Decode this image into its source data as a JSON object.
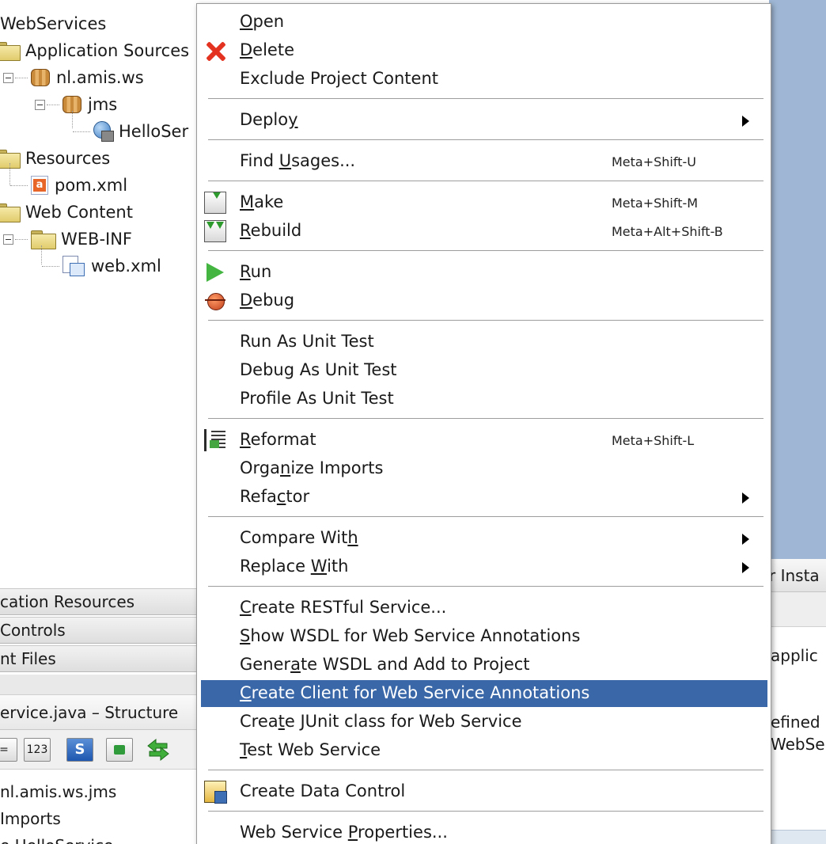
{
  "project_tree": {
    "root_label": "WebServices",
    "items": [
      {
        "label": "Application Sources",
        "icon": "folder-icon"
      },
      {
        "label": "nl.amis.ws",
        "icon": "package-icon"
      },
      {
        "label": "jms",
        "icon": "package-icon"
      },
      {
        "label": "HelloSer",
        "icon": "web-service-icon"
      },
      {
        "label": "Resources",
        "icon": "folder-icon"
      },
      {
        "label": "pom.xml",
        "icon": "maven-file-icon"
      },
      {
        "label": "Web Content",
        "icon": "folder-icon"
      },
      {
        "label": "WEB-INF",
        "icon": "folder-icon"
      },
      {
        "label": "web.xml",
        "icon": "xml-file-icon"
      }
    ]
  },
  "accordions": [
    {
      "label": "cation Resources"
    },
    {
      "label": "Controls"
    },
    {
      "label": "nt Files"
    }
  ],
  "structure": {
    "title": "ervice.java – Structure",
    "toolbar": {
      "btn_sort_label": "=",
      "btn_123_label": "123",
      "btn_s_label": "S"
    },
    "rows": [
      {
        "label": "nl.amis.ws.jms"
      },
      {
        "label": "Imports"
      },
      {
        "label": "e HelloService"
      }
    ]
  },
  "right_panel": {
    "tab_label": "r Insta",
    "line1": "applic",
    "line2": "efined",
    "line3": "WebSer"
  },
  "context_menu": {
    "items": [
      {
        "pre": "",
        "u": "O",
        "post": "pen",
        "shortcut": "",
        "icon": ""
      },
      {
        "pre": "",
        "u": "D",
        "post": "elete",
        "shortcut": "",
        "icon": "delete-icon"
      },
      {
        "pre": "Exclude Project Content",
        "u": "",
        "post": "",
        "shortcut": "",
        "icon": ""
      },
      {
        "pre": "Deplo",
        "u": "y",
        "post": "",
        "shortcut": "",
        "icon": "",
        "submenu": true
      },
      {
        "pre": "Find ",
        "u": "U",
        "post": "sages...",
        "shortcut": "Meta+Shift-U",
        "icon": ""
      },
      {
        "pre": "",
        "u": "M",
        "post": "ake",
        "shortcut": "Meta+Shift-M",
        "icon": "make-icon"
      },
      {
        "pre": "",
        "u": "R",
        "post": "ebuild",
        "shortcut": "Meta+Alt+Shift-B",
        "icon": "rebuild-icon"
      },
      {
        "pre": "",
        "u": "R",
        "post": "un",
        "shortcut": "",
        "icon": "run-icon"
      },
      {
        "pre": "",
        "u": "D",
        "post": "ebug",
        "shortcut": "",
        "icon": "debug-icon"
      },
      {
        "pre": "Run As Unit Test",
        "u": "",
        "post": "",
        "shortcut": "",
        "icon": ""
      },
      {
        "pre": "Debug As Unit Test",
        "u": "",
        "post": "",
        "shortcut": "",
        "icon": ""
      },
      {
        "pre": "Profile As Unit Test",
        "u": "",
        "post": "",
        "shortcut": "",
        "icon": ""
      },
      {
        "pre": "",
        "u": "R",
        "post": "eformat",
        "shortcut": "Meta+Shift-L",
        "icon": "reformat-icon"
      },
      {
        "pre": "Orga",
        "u": "n",
        "post": "ize Imports",
        "shortcut": "",
        "icon": ""
      },
      {
        "pre": "Refa",
        "u": "c",
        "post": "tor",
        "shortcut": "",
        "icon": "",
        "submenu": true
      },
      {
        "pre": "Compare Wit",
        "u": "h",
        "post": "",
        "shortcut": "",
        "icon": "",
        "submenu": true
      },
      {
        "pre": "Replace ",
        "u": "W",
        "post": "ith",
        "shortcut": "",
        "icon": "",
        "submenu": true
      },
      {
        "pre": "",
        "u": "C",
        "post": "reate RESTful Service...",
        "shortcut": "",
        "icon": ""
      },
      {
        "pre": "",
        "u": "S",
        "post": "how WSDL for Web Service Annotations",
        "shortcut": "",
        "icon": ""
      },
      {
        "pre": "Gener",
        "u": "a",
        "post": "te WSDL and Add to Project",
        "shortcut": "",
        "icon": ""
      },
      {
        "pre": "",
        "u": "C",
        "post": "reate Client for Web Service Annotations",
        "shortcut": "",
        "icon": "",
        "selected": true
      },
      {
        "pre": "Crea",
        "u": "t",
        "post": "e JUnit class for Web Service",
        "shortcut": "",
        "icon": ""
      },
      {
        "pre": "",
        "u": "T",
        "post": "est Web Service",
        "shortcut": "",
        "icon": ""
      },
      {
        "pre": "Create Data Control",
        "u": "",
        "post": "",
        "shortcut": "",
        "icon": "data-control-icon"
      },
      {
        "pre": "Web Service ",
        "u": "P",
        "post": "roperties...",
        "shortcut": "",
        "icon": ""
      }
    ]
  },
  "colors": {
    "menu_selection": "#3a67a7",
    "desktop_blue": "#9fb7d4"
  }
}
